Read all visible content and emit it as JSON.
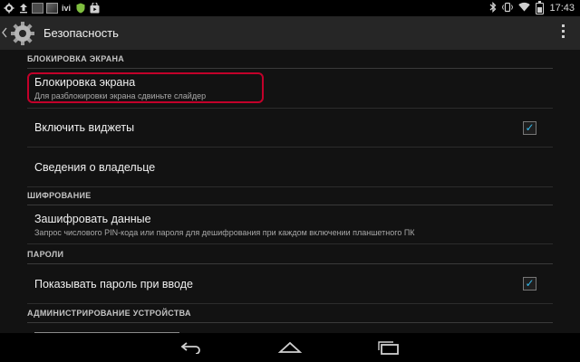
{
  "status_bar": {
    "time": "17:43",
    "left_icons": [
      "gear-notification-icon",
      "upload-icon",
      "image-notification-icon",
      "image-notification-icon",
      "ivi-app-icon",
      "shield-icon",
      "store-icon"
    ],
    "ivi_label": "ivi",
    "right_icons": [
      "bluetooth-icon",
      "vibrate-icon",
      "wifi-icon",
      "battery-icon"
    ]
  },
  "action_bar": {
    "title": "Безопасность",
    "icon": "settings-gear-icon"
  },
  "sections": [
    {
      "header": "БЛОКИРОВКА ЭКРАНА",
      "items": [
        {
          "title": "Блокировка экрана",
          "subtitle": "Для разблокировки экрана сдвиньте слайдер",
          "highlighted": true
        },
        {
          "title": "Включить виджеты",
          "checked": true
        },
        {
          "title": "Сведения о владельце"
        }
      ]
    },
    {
      "header": "ШИФРОВАНИЕ",
      "items": [
        {
          "title": "Зашифровать данные",
          "subtitle": "Запрос числового PIN-кода или пароля для дешифрования при каждом включении планшетного ПК"
        }
      ]
    },
    {
      "header": "ПАРОЛИ",
      "items": [
        {
          "title": "Показывать пароль при вводе",
          "checked": true
        }
      ]
    },
    {
      "header": "АДМИНИСТРИРОВАНИЕ УСТРОЙСТВА",
      "items": []
    }
  ],
  "nav_bar": [
    "back-icon",
    "home-icon",
    "recent-apps-icon"
  ],
  "colors": {
    "accent": "#33b5e5",
    "highlight_outline": "#c2002a",
    "background": "#121212",
    "action_bar": "#262626"
  }
}
